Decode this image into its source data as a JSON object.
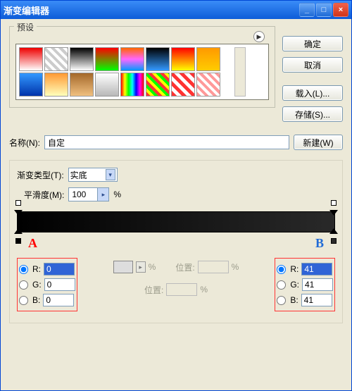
{
  "window": {
    "title": "渐变编辑器"
  },
  "titlebar_buttons": {
    "min": "_",
    "max": "□",
    "close": "×"
  },
  "presets": {
    "legend": "预设",
    "play_icon": "▶",
    "swatches": [
      "linear-gradient(#e00,#fff)",
      "repeating-linear-gradient(45deg,#fff 0 4px,#ccc 4px 8px)",
      "linear-gradient(#000,#fff)",
      "linear-gradient(#f00,#0f0)",
      "linear-gradient(#f60,#f6f,#09f)",
      "linear-gradient(#000,#39f)",
      "linear-gradient(#f00,#ff0)",
      "linear-gradient(#f90,#fc0)",
      "linear-gradient(#39f,#03a)",
      "linear-gradient(#f93,#ffb)",
      "linear-gradient(#a4682a,#f0c080)",
      "linear-gradient(#fff,#b8b8b8)",
      "linear-gradient(90deg,#f00,#ff0,#0f0,#0ff,#00f,#f0f,#f00)",
      "repeating-linear-gradient(45deg,#f33 0 4px,#ff0 4px 8px,#0f0 8px 12px)",
      "repeating-linear-gradient(45deg,#f33 0 5px,#fff 5px 10px)",
      "repeating-linear-gradient(45deg,#f99 0 4px,#fff 4px 8px)"
    ]
  },
  "side": {
    "ok": "确定",
    "cancel": "取消",
    "load": "载入(L)...",
    "save": "存储(S)..."
  },
  "name": {
    "label": "名称(N):",
    "value": "自定",
    "new": "新建(W)"
  },
  "gradient": {
    "type_label": "渐变类型(T):",
    "type_value": "实底",
    "smooth_label": "平滑度(M):",
    "smooth_value": "100",
    "percent": "%"
  },
  "marker_letters": {
    "a": "A",
    "b": "B"
  },
  "rgbA": {
    "r_label": "R:",
    "g_label": "G:",
    "b_label": "B:",
    "r": "0",
    "g": "0",
    "b": "0"
  },
  "rgbB": {
    "r_label": "R:",
    "g_label": "G:",
    "b_label": "B:",
    "r": "41",
    "g": "41",
    "b": "41"
  },
  "mid": {
    "pos_label": "位置:",
    "percent": "%"
  }
}
